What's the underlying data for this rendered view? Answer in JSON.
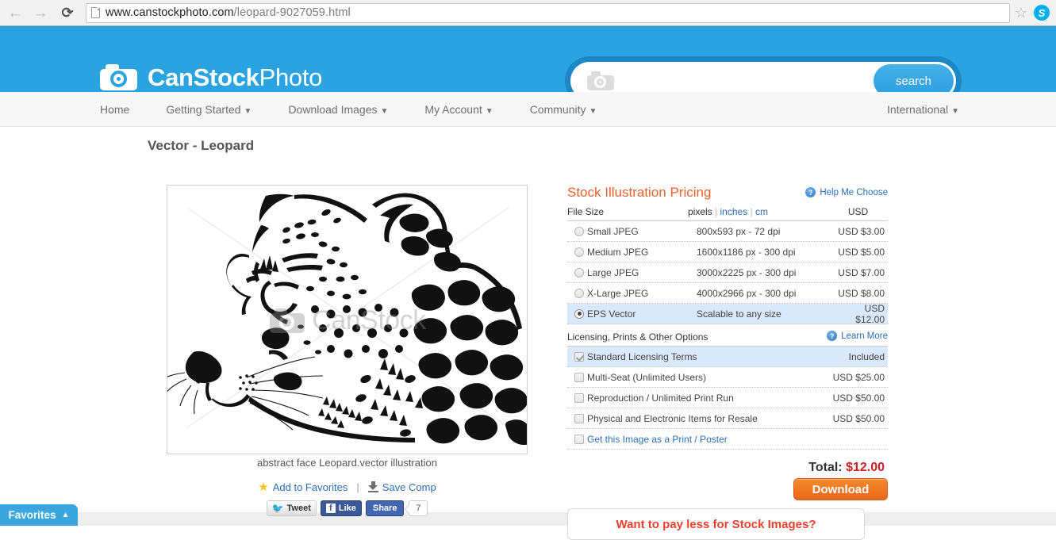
{
  "browser": {
    "back_icon": "back-arrow-icon",
    "forward_icon": "forward-arrow-icon",
    "reload_glyph": "⟳",
    "url_main": "www.canstockphoto.com",
    "url_path": "/leopard-9027059.html",
    "star_glyph": "☆",
    "skype_label": "S"
  },
  "header": {
    "logo_bold": "CanStock",
    "logo_light": "Photo",
    "search_value": "",
    "search_placeholder": "",
    "search_button": "search"
  },
  "nav": {
    "items": [
      {
        "label": "Home",
        "caret": false
      },
      {
        "label": "Getting Started",
        "caret": true
      },
      {
        "label": "Download Images",
        "caret": true
      },
      {
        "label": "My Account",
        "caret": true
      },
      {
        "label": "Community",
        "caret": true
      }
    ],
    "right": {
      "label": "International",
      "caret": true
    },
    "caret_glyph": "▼"
  },
  "page": {
    "title": "Vector - Leopard",
    "caption": "abstract face Leopard.vector illustration",
    "watermark_text": "CanStock",
    "add_to_favorites": "Add to Favorites",
    "save_comp": "Save Comp",
    "separator": "|"
  },
  "social": {
    "tweet": "Tweet",
    "like": "Like",
    "share": "Share",
    "share_count": "7",
    "fb_mark": "f",
    "bird_glyph": "✓"
  },
  "pricing": {
    "title": "Stock Illustration Pricing",
    "help_link": "Help Me Choose",
    "help_icon_glyph": "?",
    "columns": {
      "file_size": "File Size",
      "pixels": "pixels",
      "inches": "inches",
      "cm": "cm",
      "bar": "|",
      "usd": "USD"
    },
    "rows": [
      {
        "name": "Small JPEG",
        "spec": "800x593 px - 72 dpi",
        "price": "USD $3.00",
        "selected": false
      },
      {
        "name": "Medium JPEG",
        "spec": "1600x1186 px - 300 dpi",
        "price": "USD $5.00",
        "selected": false
      },
      {
        "name": "Large JPEG",
        "spec": "3000x2225 px - 300 dpi",
        "price": "USD $7.00",
        "selected": false
      },
      {
        "name": "X-Large JPEG",
        "spec": "4000x2966 px - 300 dpi",
        "price": "USD $8.00",
        "selected": false
      },
      {
        "name": "EPS Vector",
        "spec": "Scalable to any size",
        "price": "USD $12.00",
        "selected": true
      }
    ]
  },
  "licensing": {
    "title": "Licensing, Prints & Other Options",
    "learn_link": "Learn More",
    "rows": [
      {
        "name": "Standard Licensing Terms",
        "value": "Included",
        "checked": true,
        "link": false
      },
      {
        "name": "Multi-Seat (Unlimited Users)",
        "value": "USD $25.00",
        "checked": false,
        "link": false
      },
      {
        "name": "Reproduction / Unlimited Print Run",
        "value": "USD $50.00",
        "checked": false,
        "link": false
      },
      {
        "name": "Physical and Electronic Items for Resale",
        "value": "USD $50.00",
        "checked": false,
        "link": false
      },
      {
        "name": "Get this Image as a Print / Poster",
        "value": "",
        "checked": false,
        "link": true
      }
    ]
  },
  "checkout": {
    "total_label": "Total:",
    "total_amount": "$12.00",
    "download_button": "Download",
    "pay_less_banner": "Want to pay less for Stock Images?"
  },
  "favorites_tab": {
    "label": "Favorites",
    "caret": "▲"
  },
  "colors": {
    "brand_blue": "#2aa3e0",
    "accent_orange": "#e8612c",
    "link_blue": "#2b6fb5",
    "total_red": "#cc1f1f",
    "selected_row": "#d9e8fb"
  }
}
